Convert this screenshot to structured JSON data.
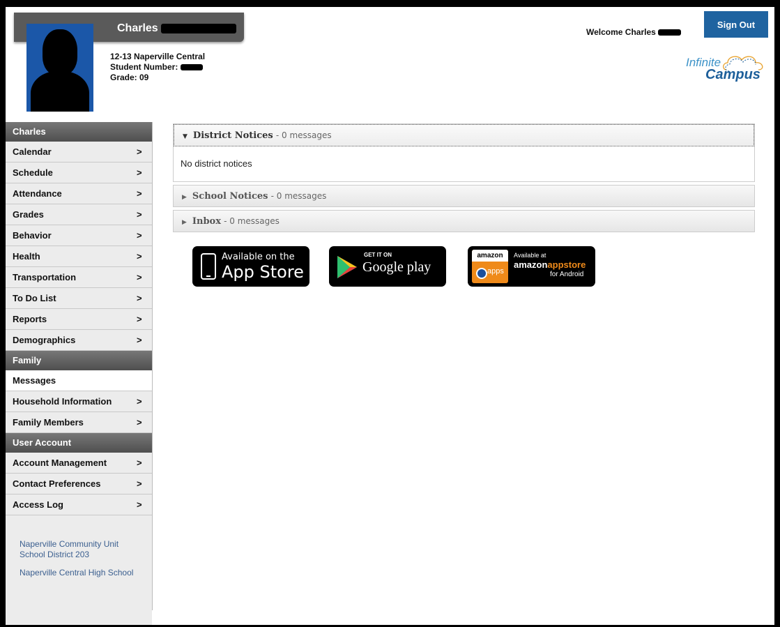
{
  "header": {
    "student_name": "Charles",
    "school_year": "12-13 Naperville Central",
    "student_number_label": "Student Number:",
    "grade": "Grade: 09",
    "welcome": "Welcome Charles",
    "sign_out": "Sign Out"
  },
  "logo": {
    "line1": "Infinite",
    "line2": "Campus"
  },
  "sidebar": {
    "student_section": "Charles",
    "student_items": [
      "Calendar",
      "Schedule",
      "Attendance",
      "Grades",
      "Behavior",
      "Health",
      "Transportation",
      "To Do List",
      "Reports",
      "Demographics"
    ],
    "family_section": "Family",
    "messages": "Messages",
    "family_items": [
      "Household Information",
      "Family Members"
    ],
    "account_section": "User Account",
    "account_items": [
      "Account Management",
      "Contact Preferences",
      "Access Log"
    ],
    "links": [
      "Naperville Community Unit School District 203",
      "Naperville Central High School"
    ]
  },
  "notices": [
    {
      "title": "District Notices",
      "count": "- 0 messages",
      "body": "No district notices"
    },
    {
      "title": "School Notices",
      "count": "- 0 messages"
    },
    {
      "title": "Inbox",
      "count": "- 0 messages"
    }
  ],
  "badges": {
    "appstore": {
      "line1": "Available on the",
      "line2": "App Store"
    },
    "google": {
      "line1": "GET IT ON",
      "line2": "Google play"
    },
    "amazon": {
      "logo": "amazon",
      "apps": "apps",
      "line1": "Available at",
      "line2a": "amazon",
      "line2b": "appstore",
      "line3": "for Android"
    }
  },
  "icons": [
    "chevron-right-icon",
    "triangle-down-icon",
    "triangle-right-icon",
    "phone-icon",
    "play-triangle-icon"
  ],
  "colors": {
    "sign_out": "#1f63a0",
    "section_header": "#555555",
    "link": "#3b5f8f"
  }
}
